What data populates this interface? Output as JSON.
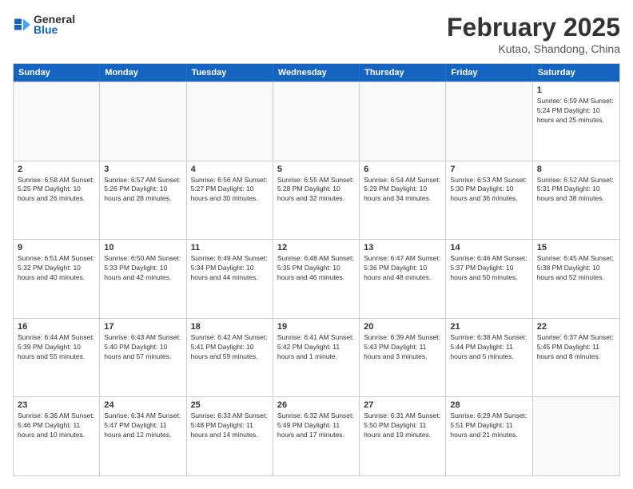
{
  "header": {
    "logo_line1": "General",
    "logo_line2": "Blue",
    "title": "February 2025",
    "subtitle": "Kutao, Shandong, China"
  },
  "days_of_week": [
    "Sunday",
    "Monday",
    "Tuesday",
    "Wednesday",
    "Thursday",
    "Friday",
    "Saturday"
  ],
  "weeks": [
    [
      {
        "day": "",
        "text": ""
      },
      {
        "day": "",
        "text": ""
      },
      {
        "day": "",
        "text": ""
      },
      {
        "day": "",
        "text": ""
      },
      {
        "day": "",
        "text": ""
      },
      {
        "day": "",
        "text": ""
      },
      {
        "day": "1",
        "text": "Sunrise: 6:59 AM\nSunset: 5:24 PM\nDaylight: 10 hours and 25 minutes."
      }
    ],
    [
      {
        "day": "2",
        "text": "Sunrise: 6:58 AM\nSunset: 5:25 PM\nDaylight: 10 hours and 26 minutes."
      },
      {
        "day": "3",
        "text": "Sunrise: 6:57 AM\nSunset: 5:26 PM\nDaylight: 10 hours and 28 minutes."
      },
      {
        "day": "4",
        "text": "Sunrise: 6:56 AM\nSunset: 5:27 PM\nDaylight: 10 hours and 30 minutes."
      },
      {
        "day": "5",
        "text": "Sunrise: 6:55 AM\nSunset: 5:28 PM\nDaylight: 10 hours and 32 minutes."
      },
      {
        "day": "6",
        "text": "Sunrise: 6:54 AM\nSunset: 5:29 PM\nDaylight: 10 hours and 34 minutes."
      },
      {
        "day": "7",
        "text": "Sunrise: 6:53 AM\nSunset: 5:30 PM\nDaylight: 10 hours and 36 minutes."
      },
      {
        "day": "8",
        "text": "Sunrise: 6:52 AM\nSunset: 5:31 PM\nDaylight: 10 hours and 38 minutes."
      }
    ],
    [
      {
        "day": "9",
        "text": "Sunrise: 6:51 AM\nSunset: 5:32 PM\nDaylight: 10 hours and 40 minutes."
      },
      {
        "day": "10",
        "text": "Sunrise: 6:50 AM\nSunset: 5:33 PM\nDaylight: 10 hours and 42 minutes."
      },
      {
        "day": "11",
        "text": "Sunrise: 6:49 AM\nSunset: 5:34 PM\nDaylight: 10 hours and 44 minutes."
      },
      {
        "day": "12",
        "text": "Sunrise: 6:48 AM\nSunset: 5:35 PM\nDaylight: 10 hours and 46 minutes."
      },
      {
        "day": "13",
        "text": "Sunrise: 6:47 AM\nSunset: 5:36 PM\nDaylight: 10 hours and 48 minutes."
      },
      {
        "day": "14",
        "text": "Sunrise: 6:46 AM\nSunset: 5:37 PM\nDaylight: 10 hours and 50 minutes."
      },
      {
        "day": "15",
        "text": "Sunrise: 6:45 AM\nSunset: 5:38 PM\nDaylight: 10 hours and 52 minutes."
      }
    ],
    [
      {
        "day": "16",
        "text": "Sunrise: 6:44 AM\nSunset: 5:39 PM\nDaylight: 10 hours and 55 minutes."
      },
      {
        "day": "17",
        "text": "Sunrise: 6:43 AM\nSunset: 5:40 PM\nDaylight: 10 hours and 57 minutes."
      },
      {
        "day": "18",
        "text": "Sunrise: 6:42 AM\nSunset: 5:41 PM\nDaylight: 10 hours and 59 minutes."
      },
      {
        "day": "19",
        "text": "Sunrise: 6:41 AM\nSunset: 5:42 PM\nDaylight: 11 hours and 1 minute."
      },
      {
        "day": "20",
        "text": "Sunrise: 6:39 AM\nSunset: 5:43 PM\nDaylight: 11 hours and 3 minutes."
      },
      {
        "day": "21",
        "text": "Sunrise: 6:38 AM\nSunset: 5:44 PM\nDaylight: 11 hours and 5 minutes."
      },
      {
        "day": "22",
        "text": "Sunrise: 6:37 AM\nSunset: 5:45 PM\nDaylight: 11 hours and 8 minutes."
      }
    ],
    [
      {
        "day": "23",
        "text": "Sunrise: 6:36 AM\nSunset: 5:46 PM\nDaylight: 11 hours and 10 minutes."
      },
      {
        "day": "24",
        "text": "Sunrise: 6:34 AM\nSunset: 5:47 PM\nDaylight: 11 hours and 12 minutes."
      },
      {
        "day": "25",
        "text": "Sunrise: 6:33 AM\nSunset: 5:48 PM\nDaylight: 11 hours and 14 minutes."
      },
      {
        "day": "26",
        "text": "Sunrise: 6:32 AM\nSunset: 5:49 PM\nDaylight: 11 hours and 17 minutes."
      },
      {
        "day": "27",
        "text": "Sunrise: 6:31 AM\nSunset: 5:50 PM\nDaylight: 11 hours and 19 minutes."
      },
      {
        "day": "28",
        "text": "Sunrise: 6:29 AM\nSunset: 5:51 PM\nDaylight: 11 hours and 21 minutes."
      },
      {
        "day": "",
        "text": ""
      }
    ]
  ]
}
